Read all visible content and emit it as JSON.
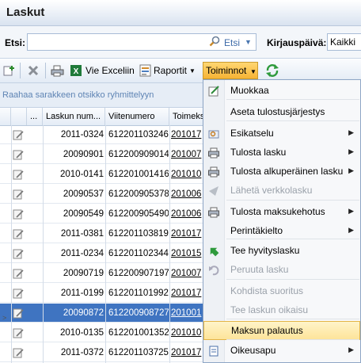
{
  "window": {
    "title": "Laskut"
  },
  "search": {
    "label": "Etsi:",
    "value": "",
    "button_label": "Etsi",
    "date_label": "Kirjauspäivä:",
    "date_value": "Kaikki"
  },
  "toolbar": {
    "excel_label": "Vie Exceliin",
    "reports_label": "Raportit",
    "actions_label": "Toiminnot"
  },
  "grid": {
    "group_hint": "Raahaa sarakkeen otsikko ryhmittelyyn",
    "columns": [
      "...",
      "Laskun num...",
      "Viitenumero",
      "Toimeks"
    ],
    "rows": [
      {
        "no": "2011-0324",
        "ref": "612201103246",
        "t": "201017"
      },
      {
        "no": "20090901",
        "ref": "612200909014",
        "t": "201007"
      },
      {
        "no": "2010-0141",
        "ref": "612201001416",
        "t": "201010"
      },
      {
        "no": "20090537",
        "ref": "612200905378",
        "t": "201006"
      },
      {
        "no": "20090549",
        "ref": "612200905490",
        "t": "201006"
      },
      {
        "no": "2011-0381",
        "ref": "612201103819",
        "t": "201017"
      },
      {
        "no": "2011-0234",
        "ref": "612201102344",
        "t": "201015"
      },
      {
        "no": "20090719",
        "ref": "612200907197",
        "t": "201007"
      },
      {
        "no": "2011-0199",
        "ref": "612201101992",
        "t": "201017"
      },
      {
        "no": "20090872",
        "ref": "612200908727",
        "t": "201001"
      },
      {
        "no": "2010-0135",
        "ref": "612201001352",
        "t": "201010"
      },
      {
        "no": "2011-0372",
        "ref": "612201103725",
        "t": "201017"
      }
    ],
    "selected_index": 9
  },
  "menu": {
    "items": [
      {
        "label": "Muokkaa",
        "icon": "edit-icon"
      },
      {
        "label": "Aseta tulostusjärjestys",
        "icon": ""
      },
      {
        "label": "Esikatselu",
        "icon": "preview-icon",
        "submenu": true
      },
      {
        "label": "Tulosta lasku",
        "icon": "print-icon",
        "submenu": true
      },
      {
        "label": "Tulosta alkuperäinen lasku",
        "icon": "print-icon",
        "submenu": true
      },
      {
        "label": "Lähetä verkkolasku",
        "icon": "send-icon",
        "disabled": true
      },
      {
        "label": "Tulosta maksukehotus",
        "icon": "print-icon",
        "submenu": true
      },
      {
        "label": "Perintäkielto",
        "icon": "",
        "submenu": true
      },
      {
        "label": "Tee hyvityslasku",
        "icon": "credit-icon"
      },
      {
        "label": "Peruuta lasku",
        "icon": "undo-icon",
        "disabled": true
      },
      {
        "label": "Kohdista suoritus",
        "icon": "",
        "disabled": true
      },
      {
        "label": "Tee laskun oikaisu",
        "icon": "",
        "disabled": true
      },
      {
        "label": "Maksun palautus",
        "icon": "",
        "highlighted": true
      },
      {
        "label": "Oikeusapu",
        "icon": "legal-icon",
        "submenu": true
      }
    ]
  },
  "colors": {
    "accent": "#f6b334",
    "selection": "#3f74c1",
    "link": "#3d6aa8"
  }
}
